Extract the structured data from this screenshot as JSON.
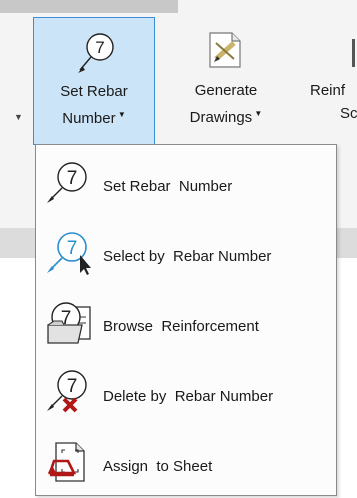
{
  "ribbon": {
    "set_rebar": {
      "line1": "Set Rebar",
      "line2": "Number"
    },
    "generate": {
      "line1": "Generate",
      "line2": "Drawings"
    },
    "reinf": {
      "line1": "Reinf",
      "line2": "Sc"
    }
  },
  "menu": {
    "items": [
      {
        "label": "Set Rebar  Number",
        "icon": "number-seven-circle-icon"
      },
      {
        "label": "Select by  Rebar Number",
        "icon": "select-by-number-icon"
      },
      {
        "label": "Browse  Reinforcement",
        "icon": "browse-reinforcement-icon"
      },
      {
        "label": "Delete by  Rebar Number",
        "icon": "delete-by-number-icon"
      },
      {
        "label": "Assign  to Sheet",
        "icon": "assign-to-sheet-icon"
      }
    ]
  },
  "icon_text": "7",
  "colors": {
    "active_fill": "#cce4f7",
    "active_border": "#3c8fd6",
    "select_blue": "#2a8fd0",
    "delete_red": "#b01818"
  }
}
